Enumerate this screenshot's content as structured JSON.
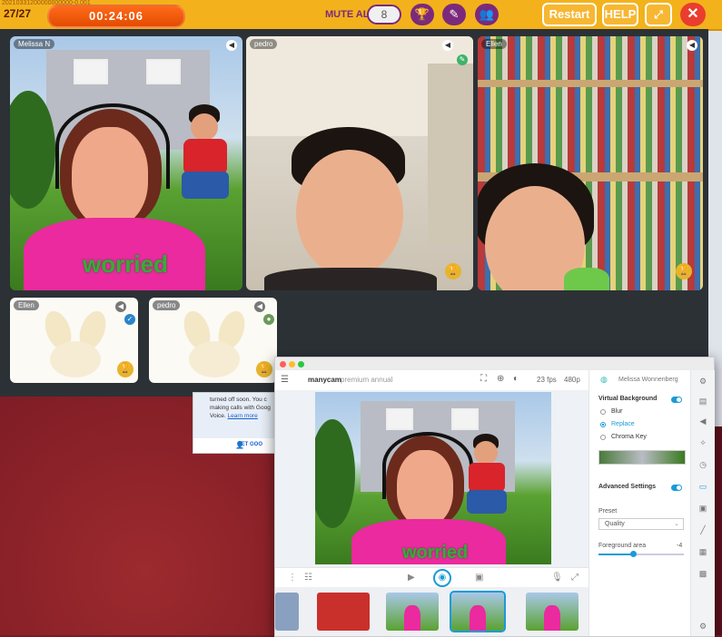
{
  "topbar": {
    "round": "27/27",
    "tiny_id": "20210331200000000000-0.001",
    "timer": "00:24:06",
    "mute_all": "MUTE ALL",
    "mute_count": "8",
    "restart": "Restart",
    "help": "HELP",
    "icons": [
      "trophy-icon",
      "pencil-icon",
      "users-icon",
      "expand-icon",
      "close-icon"
    ]
  },
  "videos": [
    {
      "name": "Melissa N",
      "caption": "worried"
    },
    {
      "name": "pedro"
    },
    {
      "name": "Ellen"
    }
  ],
  "small_tiles": [
    {
      "name": "Ellen"
    },
    {
      "name": "pedro"
    }
  ],
  "google_voice": {
    "text": "turned off soon. You c making calls with Goog Voice.",
    "link": "Learn more",
    "action": "GET GOO"
  },
  "manycam": {
    "brand": "manycam",
    "plan": "premium annual",
    "fps": "23 fps",
    "resolution": "480p",
    "user": "Melissa Wonnenberg",
    "caption": "worried",
    "side": {
      "virtual_background": "Virtual Background",
      "options": [
        "Blur",
        "Replace",
        "Chroma Key"
      ],
      "selected": "Replace",
      "advanced": "Advanced Settings",
      "preset_label": "Preset",
      "preset_value": "Quality",
      "foreground_label": "Foreground area",
      "foreground_value": "-4"
    }
  },
  "colors": {
    "accent": "#f3b21b",
    "purple": "#7b2a7b",
    "timer": "#e34c00",
    "blue": "#1a9bd7"
  }
}
